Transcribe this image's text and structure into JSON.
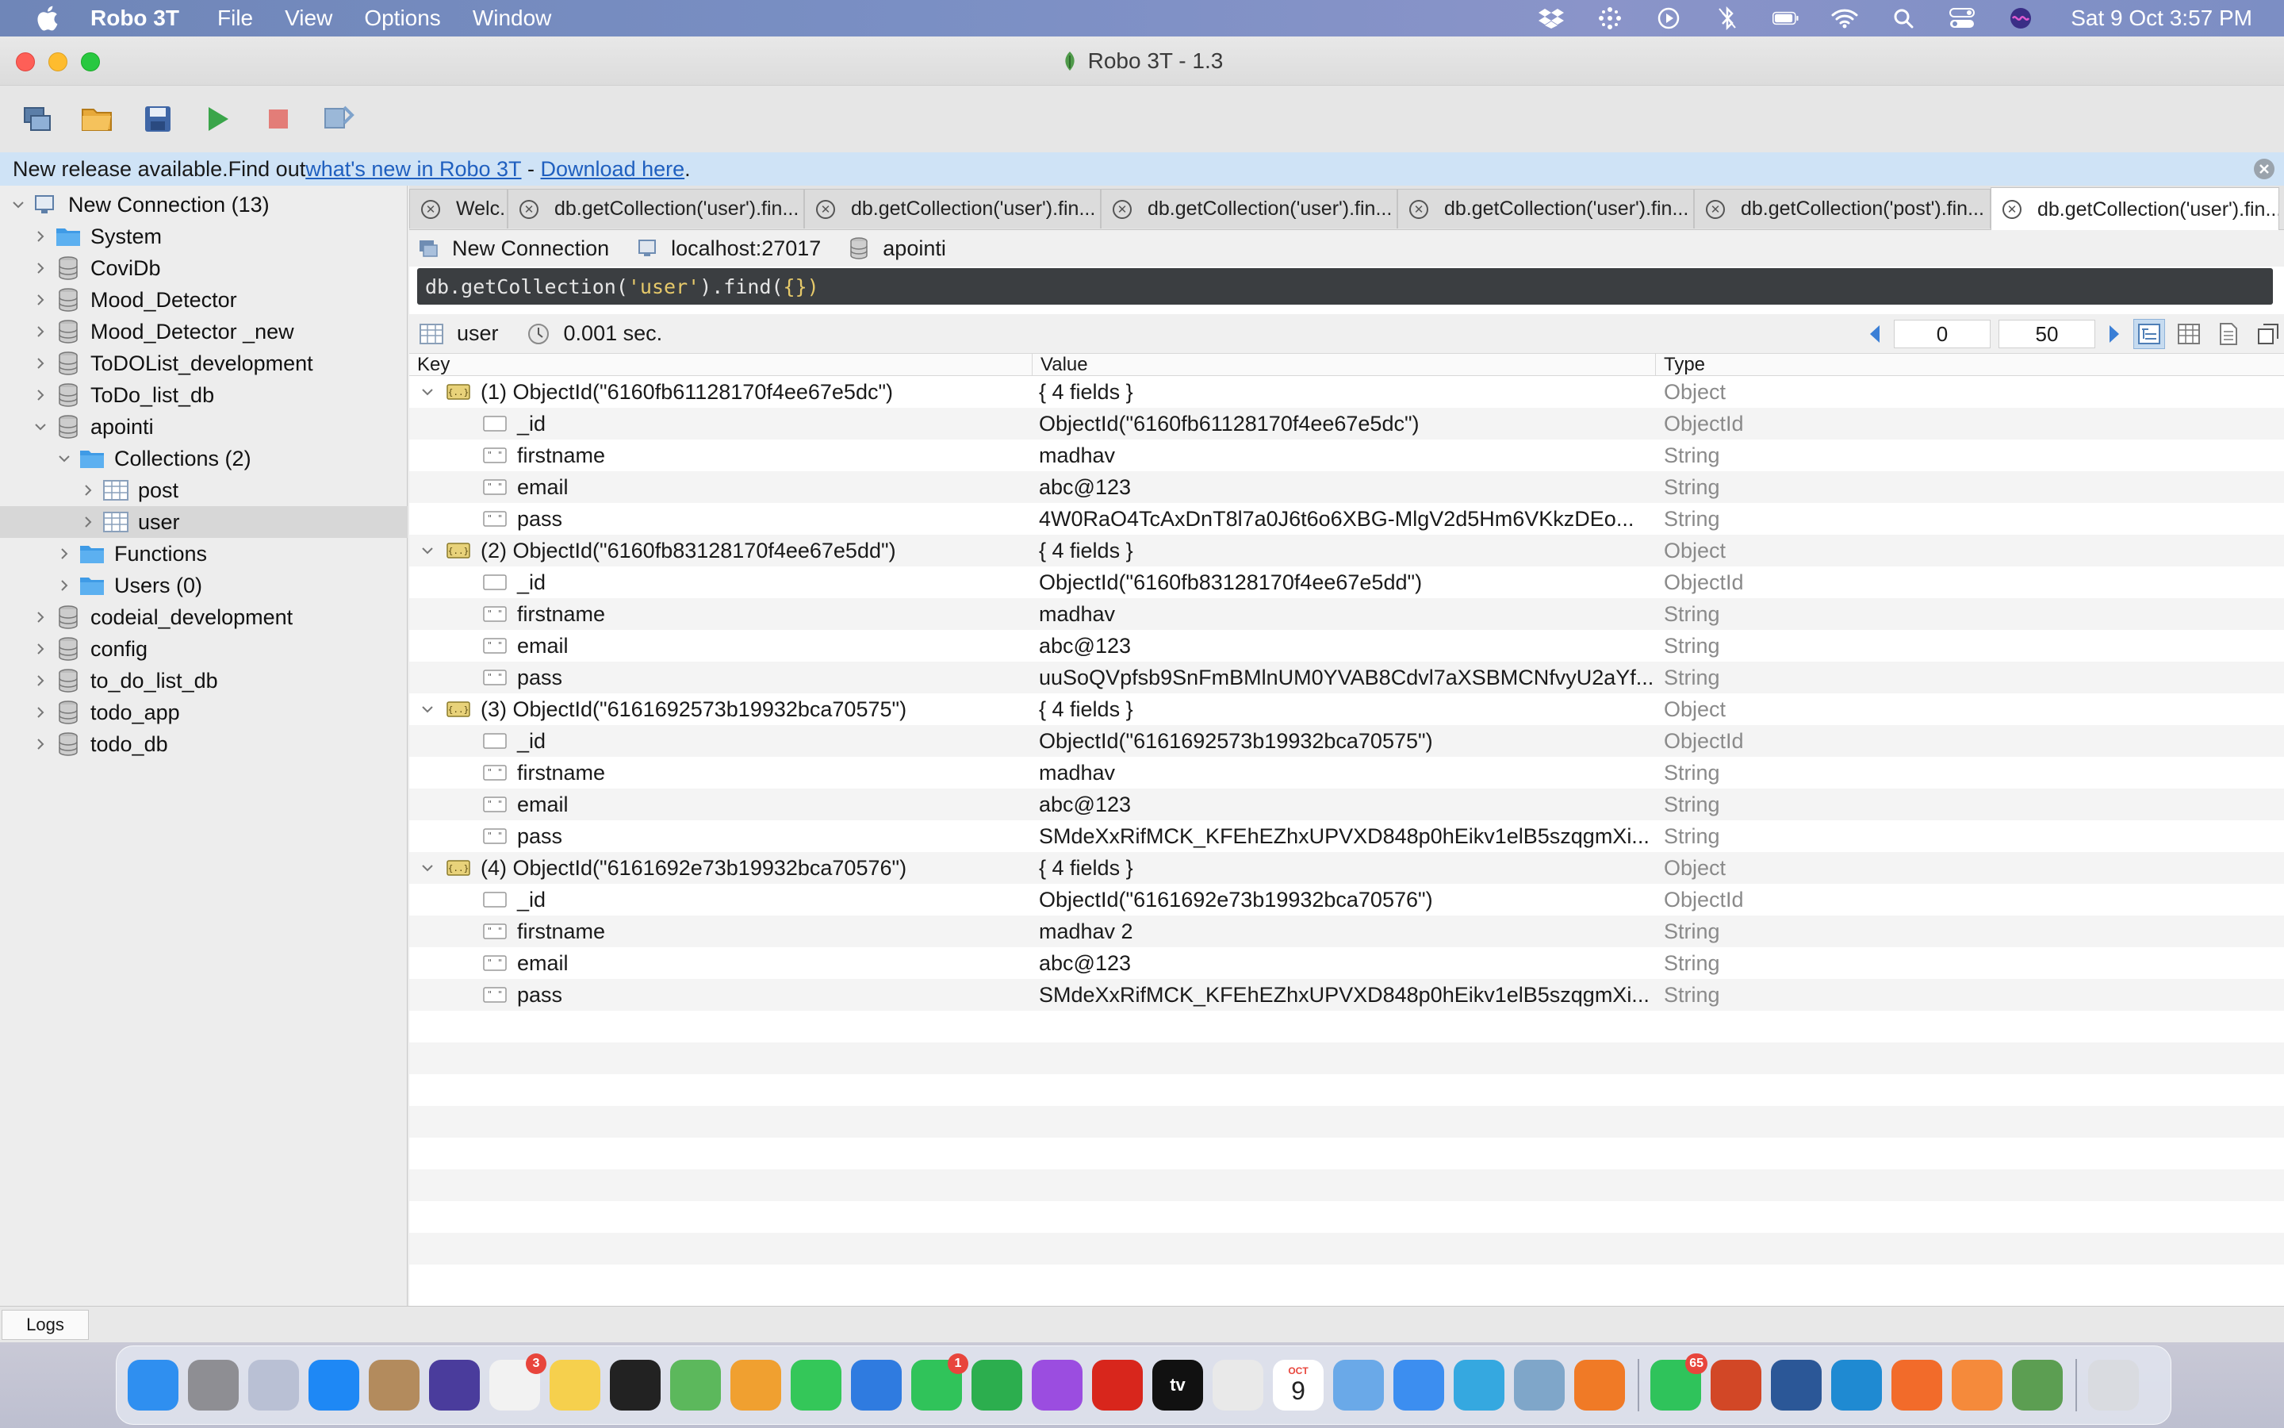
{
  "menubar": {
    "app_name": "Robo 3T",
    "menus": [
      "File",
      "View",
      "Options",
      "Window"
    ],
    "clock": "Sat 9 Oct  3:57 PM"
  },
  "window": {
    "title": "Robo 3T - 1.3"
  },
  "infobar": {
    "text_prefix": "New release available.Find out ",
    "link_whats_new": "what's new in Robo 3T",
    "separator": " - ",
    "link_download": "Download here",
    "suffix": "."
  },
  "sidebar": {
    "items": [
      {
        "label": "New Connection (13)",
        "icon": "server-icon",
        "level": 0,
        "expanded": true
      },
      {
        "label": "System",
        "icon": "folder-icon",
        "level": 1,
        "expanded": false
      },
      {
        "label": "CoviDb",
        "icon": "database-icon",
        "level": 1,
        "expanded": false
      },
      {
        "label": "Mood_Detector",
        "icon": "database-icon",
        "level": 1,
        "expanded": false
      },
      {
        "label": "Mood_Detector _new",
        "icon": "database-icon",
        "level": 1,
        "expanded": false
      },
      {
        "label": "ToDOList_development",
        "icon": "database-icon",
        "level": 1,
        "expanded": false
      },
      {
        "label": "ToDo_list_db",
        "icon": "database-icon",
        "level": 1,
        "expanded": false
      },
      {
        "label": "apointi",
        "icon": "database-icon",
        "level": 1,
        "expanded": true
      },
      {
        "label": "Collections (2)",
        "icon": "folder-icon",
        "level": 2,
        "expanded": true
      },
      {
        "label": "post",
        "icon": "table-icon",
        "level": 3,
        "expanded": false
      },
      {
        "label": "user",
        "icon": "table-icon",
        "level": 3,
        "expanded": false,
        "selected": true
      },
      {
        "label": "Functions",
        "icon": "folder-icon",
        "level": 2,
        "expanded": false
      },
      {
        "label": "Users (0)",
        "icon": "folder-icon",
        "level": 2,
        "expanded": false
      },
      {
        "label": "codeial_development",
        "icon": "database-icon",
        "level": 1,
        "expanded": false
      },
      {
        "label": "config",
        "icon": "database-icon",
        "level": 1,
        "expanded": false
      },
      {
        "label": "to_do_list_db",
        "icon": "database-icon",
        "level": 1,
        "expanded": false
      },
      {
        "label": "todo_app",
        "icon": "database-icon",
        "level": 1,
        "expanded": false
      },
      {
        "label": "todo_db",
        "icon": "database-icon",
        "level": 1,
        "expanded": false
      }
    ]
  },
  "tabs": [
    {
      "label": "Welc..."
    },
    {
      "label": "db.getCollection('user').fin..."
    },
    {
      "label": "db.getCollection('user').fin..."
    },
    {
      "label": "db.getCollection('user').fin..."
    },
    {
      "label": "db.getCollection('user').fin..."
    },
    {
      "label": "db.getCollection('post').fin..."
    },
    {
      "label": "db.getCollection('user').fin...",
      "active": true
    }
  ],
  "connection": {
    "name": "New Connection",
    "host": "localhost:27017",
    "database": "apointi"
  },
  "query": {
    "prefix": "db.getCollection(",
    "collection_literal": "'user'",
    "suffix": ").find(",
    "argument": "{}",
    "close": ")"
  },
  "result": {
    "collection": "user",
    "time": "0.001 sec.",
    "skip": "0",
    "limit": "50"
  },
  "grid": {
    "headers": {
      "key": "Key",
      "value": "Value",
      "type": "Type"
    },
    "documents": [
      {
        "key": "(1) ObjectId(\"6160fb61128170f4ee67e5dc\")",
        "value": "{ 4 fields }",
        "type": "Object",
        "fields": [
          {
            "key": "_id",
            "value": "ObjectId(\"6160fb61128170f4ee67e5dc\")",
            "type": "ObjectId",
            "icon": "id-icon"
          },
          {
            "key": "firstname",
            "value": "madhav",
            "type": "String",
            "icon": "string-icon"
          },
          {
            "key": "email",
            "value": "abc@123",
            "type": "String",
            "icon": "string-icon"
          },
          {
            "key": "pass",
            "value": "4W0RaO4TcAxDnT8l7a0J6t6o6XBG-MlgV2d5Hm6VKkzDEo...",
            "type": "String",
            "icon": "string-icon"
          }
        ]
      },
      {
        "key": "(2) ObjectId(\"6160fb83128170f4ee67e5dd\")",
        "value": "{ 4 fields }",
        "type": "Object",
        "fields": [
          {
            "key": "_id",
            "value": "ObjectId(\"6160fb83128170f4ee67e5dd\")",
            "type": "ObjectId",
            "icon": "id-icon"
          },
          {
            "key": "firstname",
            "value": "madhav",
            "type": "String",
            "icon": "string-icon"
          },
          {
            "key": "email",
            "value": "abc@123",
            "type": "String",
            "icon": "string-icon"
          },
          {
            "key": "pass",
            "value": "uuSoQVpfsb9SnFmBMlnUM0YVAB8Cdvl7aXSBMCNfvyU2aYf...",
            "type": "String",
            "icon": "string-icon"
          }
        ]
      },
      {
        "key": "(3) ObjectId(\"6161692573b19932bca70575\")",
        "value": "{ 4 fields }",
        "type": "Object",
        "fields": [
          {
            "key": "_id",
            "value": "ObjectId(\"6161692573b19932bca70575\")",
            "type": "ObjectId",
            "icon": "id-icon"
          },
          {
            "key": "firstname",
            "value": "madhav",
            "type": "String",
            "icon": "string-icon"
          },
          {
            "key": "email",
            "value": "abc@123",
            "type": "String",
            "icon": "string-icon"
          },
          {
            "key": "pass",
            "value": "SMdeXxRifMCK_KFEhEZhxUPVXD848p0hEikv1elB5szqgmXi...",
            "type": "String",
            "icon": "string-icon"
          }
        ]
      },
      {
        "key": "(4) ObjectId(\"6161692e73b19932bca70576\")",
        "value": "{ 4 fields }",
        "type": "Object",
        "fields": [
          {
            "key": "_id",
            "value": "ObjectId(\"6161692e73b19932bca70576\")",
            "type": "ObjectId",
            "icon": "id-icon"
          },
          {
            "key": "firstname",
            "value": "madhav 2",
            "type": "String",
            "icon": "string-icon"
          },
          {
            "key": "email",
            "value": "abc@123",
            "type": "String",
            "icon": "string-icon"
          },
          {
            "key": "pass",
            "value": "SMdeXxRifMCK_KFEhEZhxUPVXD848p0hEikv1elB5szqgmXi...",
            "type": "String",
            "icon": "string-icon"
          }
        ]
      }
    ]
  },
  "logs": {
    "label": "Logs"
  },
  "dock": {
    "apps": [
      {
        "name": "finder-icon",
        "color": "#2f8ff0"
      },
      {
        "name": "system-preferences-icon",
        "color": "#8e8e93"
      },
      {
        "name": "launchpad-icon",
        "color": "#b9c0d4"
      },
      {
        "name": "app-store-icon",
        "color": "#1e88f5"
      },
      {
        "name": "contacts-icon",
        "color": "#b38b5d"
      },
      {
        "name": "siri-icon",
        "color": "#4a3c9c"
      },
      {
        "name": "reminders-icon",
        "color": "#f2f2f2",
        "badge": "3"
      },
      {
        "name": "notes-icon",
        "color": "#f6d04d"
      },
      {
        "name": "activity-monitor-icon",
        "color": "#222222"
      },
      {
        "name": "maps-icon",
        "color": "#5cb85c"
      },
      {
        "name": "photos-icon",
        "color": "#f0a030"
      },
      {
        "name": "messages-icon",
        "color": "#34c759"
      },
      {
        "name": "keynote-icon",
        "color": "#2f7be0"
      },
      {
        "name": "facetime-icon",
        "color": "#30c35a",
        "badge": "1"
      },
      {
        "name": "numbers-icon",
        "color": "#2cae4e"
      },
      {
        "name": "podcasts-icon",
        "color": "#9b4de0"
      },
      {
        "name": "acrobat-icon",
        "color": "#d8261c"
      },
      {
        "name": "apple-tv-icon",
        "color": "#111111"
      },
      {
        "name": "chrome-icon",
        "color": "#e9e9e9"
      },
      {
        "name": "calendar-icon",
        "color": "#ffffff"
      },
      {
        "name": "xcode-tool-icon",
        "color": "#6aa9e8"
      },
      {
        "name": "mail-icon",
        "color": "#3c8ef0"
      },
      {
        "name": "grid-app-icon",
        "color": "#35a8e0"
      },
      {
        "name": "preview-icon",
        "color": "#7fa6c9"
      },
      {
        "name": "firefox-icon",
        "color": "#f07a26"
      },
      {
        "name": "whatsapp-icon",
        "color": "#2fc35b",
        "badge": "65"
      },
      {
        "name": "powerpoint-icon",
        "color": "#d24726"
      },
      {
        "name": "word-icon",
        "color": "#2b5797"
      },
      {
        "name": "vscode-icon",
        "color": "#1f8ad2"
      },
      {
        "name": "sketch-icon",
        "color": "#f26b2a"
      },
      {
        "name": "postman-icon",
        "color": "#f58a3b"
      },
      {
        "name": "robo3t-icon",
        "color": "#5c9e52"
      },
      {
        "name": "trash-icon",
        "color": "#d9dbe0"
      }
    ],
    "calendar_month": "OCT",
    "calendar_day": "9",
    "tv_label": "tv"
  }
}
